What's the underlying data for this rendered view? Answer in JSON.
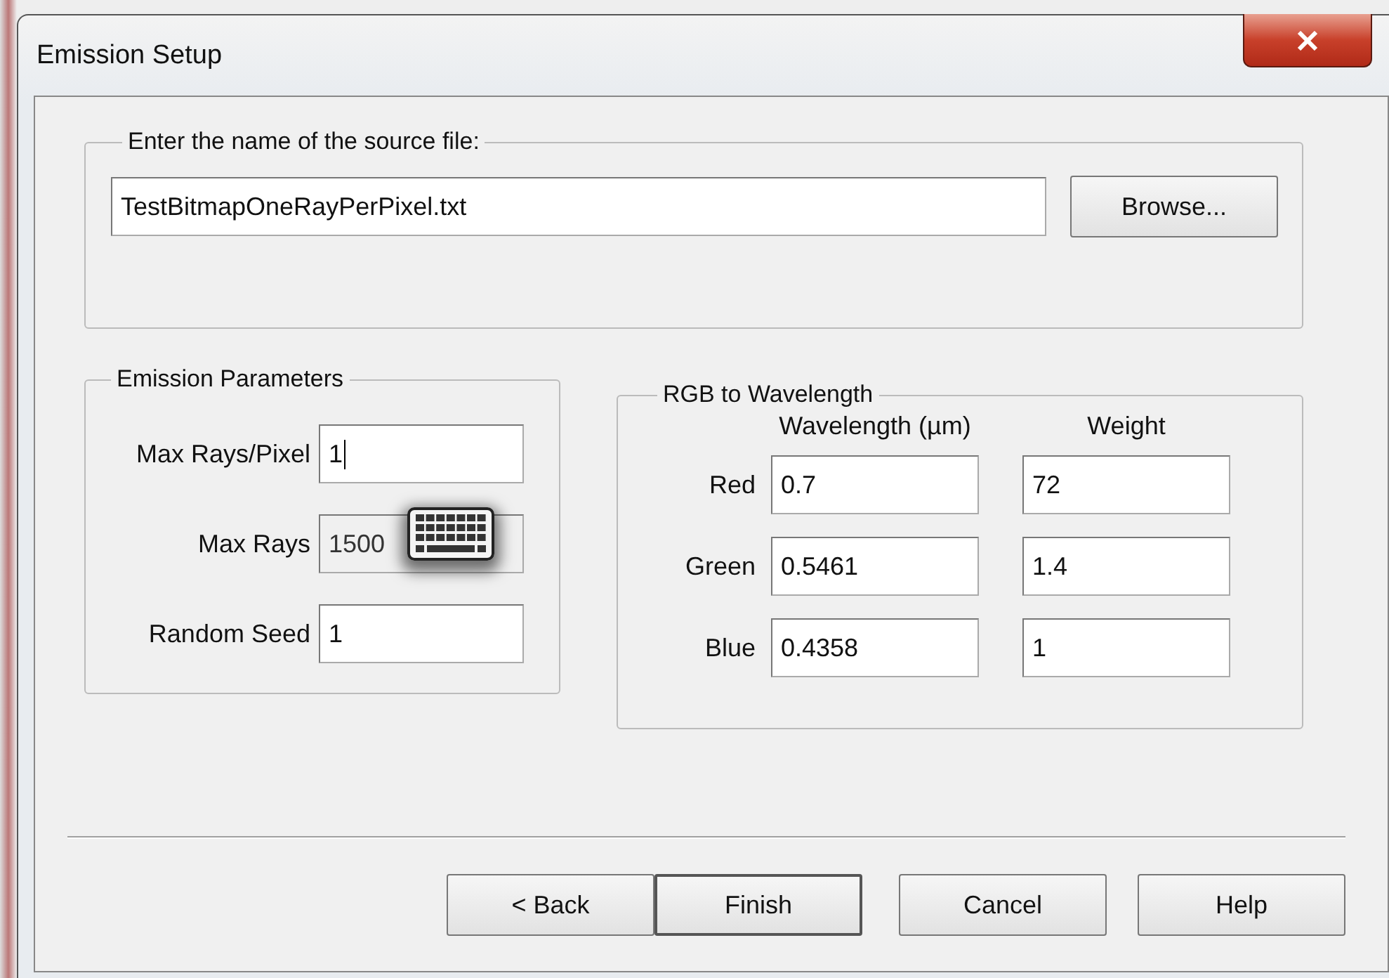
{
  "window": {
    "title": "Emission Setup"
  },
  "source": {
    "label": "Enter the name of the source file:",
    "value": "TestBitmapOneRayPerPixel.txt",
    "button": "Browse..."
  },
  "emission": {
    "title": "Emission Parameters",
    "fields": [
      {
        "label": "Max Rays/Pixel",
        "value": "1",
        "disabled": false,
        "focused": true,
        "keyboard_overlay": false
      },
      {
        "label": "Max Rays",
        "value": "1500",
        "disabled": true,
        "focused": false,
        "keyboard_overlay": true
      },
      {
        "label": "Random Seed",
        "value": "1",
        "disabled": false,
        "focused": false,
        "keyboard_overlay": false
      }
    ]
  },
  "rgb": {
    "title": "RGB to Wavelength",
    "columns": [
      "Wavelength (µm)",
      "Weight"
    ],
    "rows": [
      {
        "label": "Red",
        "wavelength": "0.7",
        "weight": "72"
      },
      {
        "label": "Green",
        "wavelength": "0.5461",
        "weight": "1.4"
      },
      {
        "label": "Blue",
        "wavelength": "0.4358",
        "weight": "1"
      }
    ]
  },
  "buttons": [
    {
      "label": "< Back",
      "default": false
    },
    {
      "label": "Finish",
      "default": true
    },
    {
      "label": "Cancel",
      "default": false
    },
    {
      "label": "Help",
      "default": false
    }
  ]
}
